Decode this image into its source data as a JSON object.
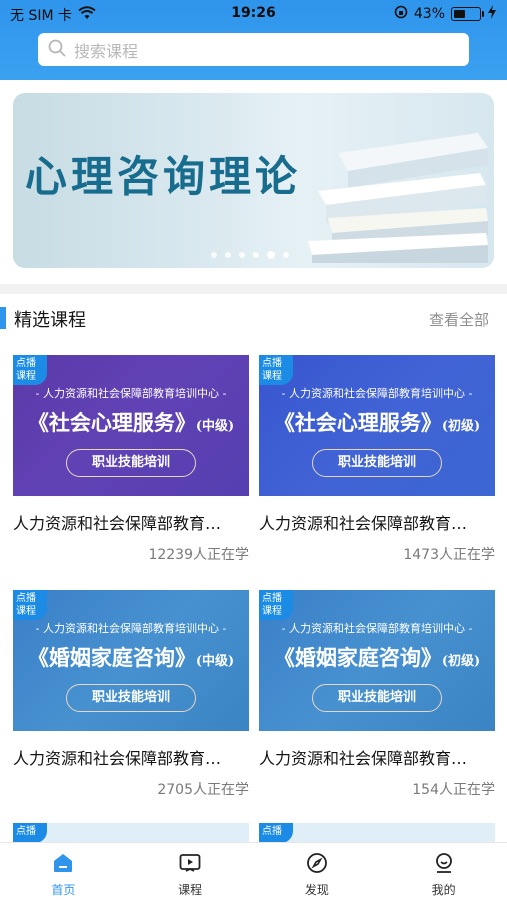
{
  "status_bar": {
    "carrier": "无 SIM 卡",
    "time": "19:26",
    "battery": "43%"
  },
  "search": {
    "placeholder": "搜索课程"
  },
  "banner": {
    "title": "心理咨询理论",
    "dots_total": 6,
    "active_dot": 5
  },
  "section": {
    "title": "精选课程",
    "more": "查看全部"
  },
  "courses": [
    {
      "badge_line1": "点播",
      "badge_line2": "课程",
      "org": "- 人力资源和社会保障部教育培训中心 -",
      "name": "《社会心理服务》",
      "level": "(中级)",
      "button": "职业技能培训",
      "title": "人力资源和社会保障部教育…",
      "count": "12239人正在学"
    },
    {
      "badge_line1": "点播",
      "badge_line2": "课程",
      "org": "- 人力资源和社会保障部教育培训中心 -",
      "name": "《社会心理服务》",
      "level": "(初级)",
      "button": "职业技能培训",
      "title": "人力资源和社会保障部教育…",
      "count": "1473人正在学"
    },
    {
      "badge_line1": "点播",
      "badge_line2": "课程",
      "org": "- 人力资源和社会保障部教育培训中心 -",
      "name": "《婚姻家庭咨询》",
      "level": "(中级)",
      "button": "职业技能培训",
      "title": "人力资源和社会保障部教育…",
      "count": "2705人正在学"
    },
    {
      "badge_line1": "点播",
      "badge_line2": "课程",
      "org": "- 人力资源和社会保障部教育培训中心 -",
      "name": "《婚姻家庭咨询》",
      "level": "(初级)",
      "button": "职业技能培训",
      "title": "人力资源和社会保障部教育…",
      "count": "154人正在学"
    }
  ],
  "peek": {
    "left_badge": "点播",
    "right_badge": "点播"
  },
  "tabbar": [
    {
      "label": "首页",
      "icon": "home-icon",
      "active": true
    },
    {
      "label": "课程",
      "icon": "play-video-icon",
      "active": false
    },
    {
      "label": "发现",
      "icon": "compass-icon",
      "active": false
    },
    {
      "label": "我的",
      "icon": "user-icon",
      "active": false
    }
  ],
  "colors": {
    "primary": "#2f95ec",
    "banner_text": "#186c8d"
  }
}
